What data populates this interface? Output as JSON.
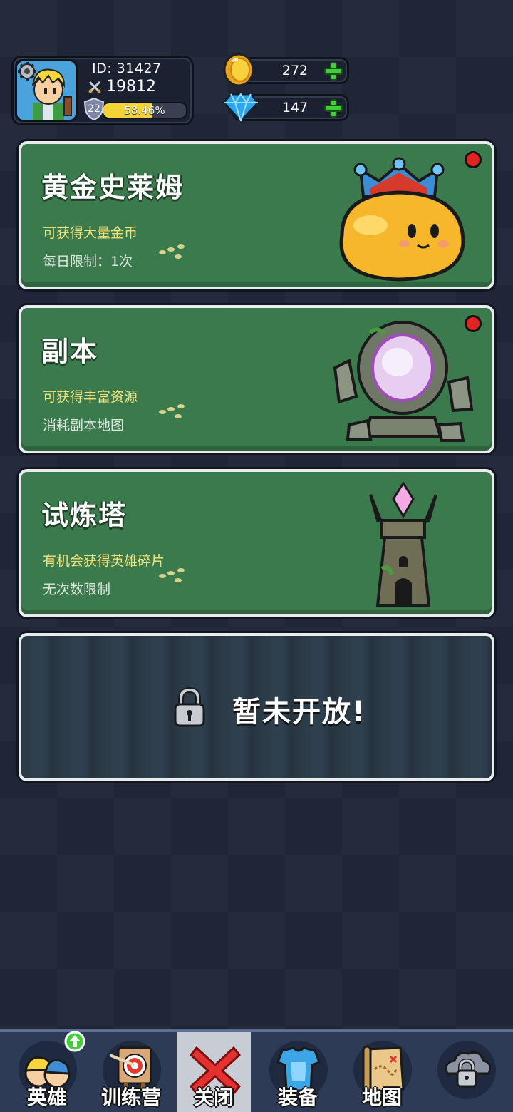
{
  "profile": {
    "id_text": "ID: 31427",
    "power": "19812",
    "level": "22",
    "xp_percent_text": "58.46%",
    "xp_fraction": 0.5846
  },
  "currency": {
    "gold": "272",
    "diamond": "147"
  },
  "modes": [
    {
      "title": "黄金史莱姆",
      "subtitle": "可获得大量金币",
      "info": "每日限制：1次",
      "has_notification": true,
      "icon": "gold-slime-king-icon"
    },
    {
      "title": "副本",
      "subtitle": "可获得丰富资源",
      "info": "消耗副本地图",
      "has_notification": true,
      "icon": "stone-portal-icon"
    },
    {
      "title": "试炼塔",
      "subtitle": "有机会获得英雄碎片",
      "info": "无次数限制",
      "has_notification": false,
      "icon": "crystal-tower-icon"
    }
  ],
  "locked_mode": {
    "label": "暂未开放!"
  },
  "nav": {
    "items": [
      {
        "label": "英雄",
        "icon": "heroes-icon",
        "badge": "up-arrow"
      },
      {
        "label": "训练营",
        "icon": "training-target-icon"
      },
      {
        "label": "关闭",
        "icon": "close-x-icon",
        "active": true
      },
      {
        "label": "装备",
        "icon": "armor-icon"
      },
      {
        "label": "地图",
        "icon": "treasure-map-icon"
      },
      {
        "label": "",
        "icon": "locked-cloud-icon"
      }
    ]
  },
  "colors": {
    "card_green": "#3a7a4d",
    "subtitle_yellow": "#f4e27a",
    "notification_red": "#e32222",
    "xp_yellow": "#f3d235",
    "plus_green": "#3fcf3a"
  }
}
